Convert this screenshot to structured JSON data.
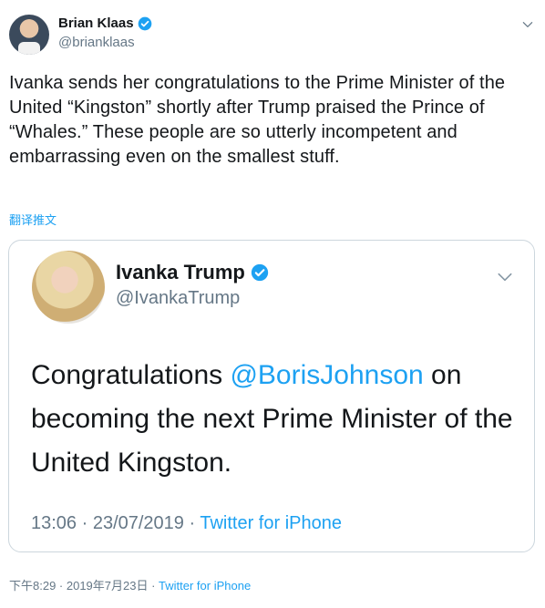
{
  "tweet": {
    "author_name": "Brian Klaas",
    "author_handle": "@brianklaas",
    "text": "Ivanka sends her congratulations to the Prime Minister of the United “Kingston” shortly after Trump praised the Prince of “Whales.” These people are so utterly incompetent and embarrassing even on the smallest stuff.",
    "translate_label": "翻译推文",
    "timestamp": "下午8:29 · 2019年7月23日 · ",
    "source": "Twitter for iPhone"
  },
  "quoted": {
    "author_name": "Ivanka Trump",
    "author_handle": "@IvankaTrump",
    "text_before": "Congratulations ",
    "mention": "@BorisJohnson",
    "text_after": " on becoming the next Prime Minister of the United Kingston.",
    "timestamp": "13:06 · 23/07/2019 · ",
    "source": "Twitter for iPhone"
  },
  "icons": {
    "verified": "verified-badge-icon",
    "caret": "chevron-down-icon"
  },
  "colors": {
    "accent": "#1da1f2",
    "text": "#14171a",
    "secondary": "#657786",
    "border": "#ccd6dd"
  }
}
